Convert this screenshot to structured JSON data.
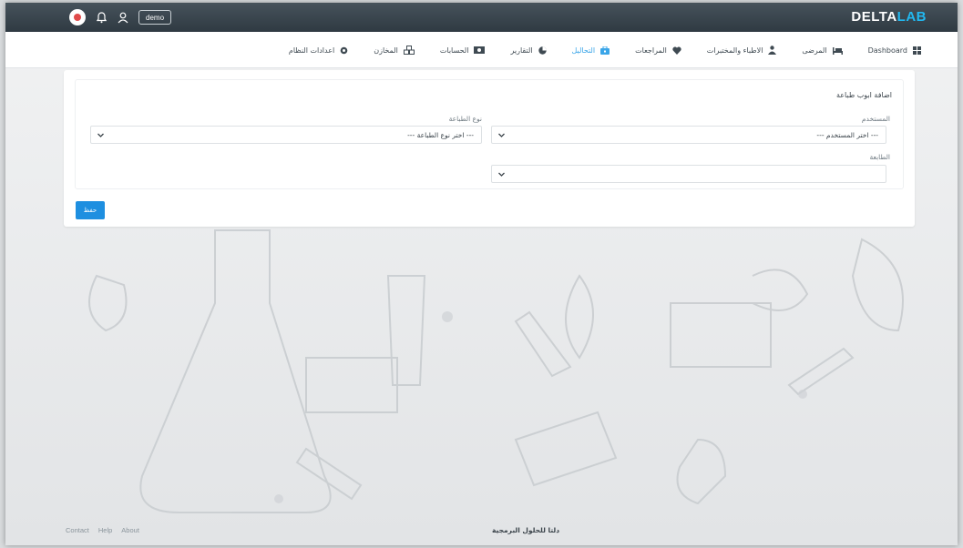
{
  "app": {
    "brand_part1": "DELTA",
    "brand_part2": "LAB",
    "brand_colors": {
      "primary": "#ffffff",
      "accent": "#22b8f0"
    }
  },
  "topbar": {
    "user_button_label": "demo",
    "icons": [
      "avatar",
      "bell-icon",
      "user-icon"
    ]
  },
  "nav": {
    "items": [
      {
        "label": "Dashboard",
        "icon": "grid-icon",
        "active": false
      },
      {
        "label": "المرضى",
        "icon": "bed-icon",
        "active": false
      },
      {
        "label": "الاطباء والمختبرات",
        "icon": "doctor-icon",
        "active": false
      },
      {
        "label": "المراجعات",
        "icon": "heart-icon",
        "active": false
      },
      {
        "label": "التحاليل",
        "icon": "briefcase-icon",
        "active": true
      },
      {
        "label": "التقارير",
        "icon": "pie-chart-icon",
        "active": false
      },
      {
        "label": "الحسابات",
        "icon": "money-icon",
        "active": false
      },
      {
        "label": "المخازن",
        "icon": "boxes-icon",
        "active": false
      },
      {
        "label": "اعدادات النظام",
        "icon": "gear-icon",
        "active": false
      }
    ],
    "active_color": "#3aa5e8"
  },
  "form": {
    "title": "اضافة ابوب طباعة",
    "user_label": "المستخدم",
    "user_placeholder": "--- اختر المستخدم ---",
    "print_type_label": "نوع الطباعة",
    "print_type_placeholder": "--- اختر نوع الطباعة ---",
    "printer_label": "الطابعة",
    "printer_value": "",
    "save_label": "حفظ",
    "save_color": "#1e8fe0"
  },
  "footer": {
    "links": [
      "Contact",
      "Help",
      "About"
    ],
    "copyright": "دلتا للحلول البرمجية"
  }
}
